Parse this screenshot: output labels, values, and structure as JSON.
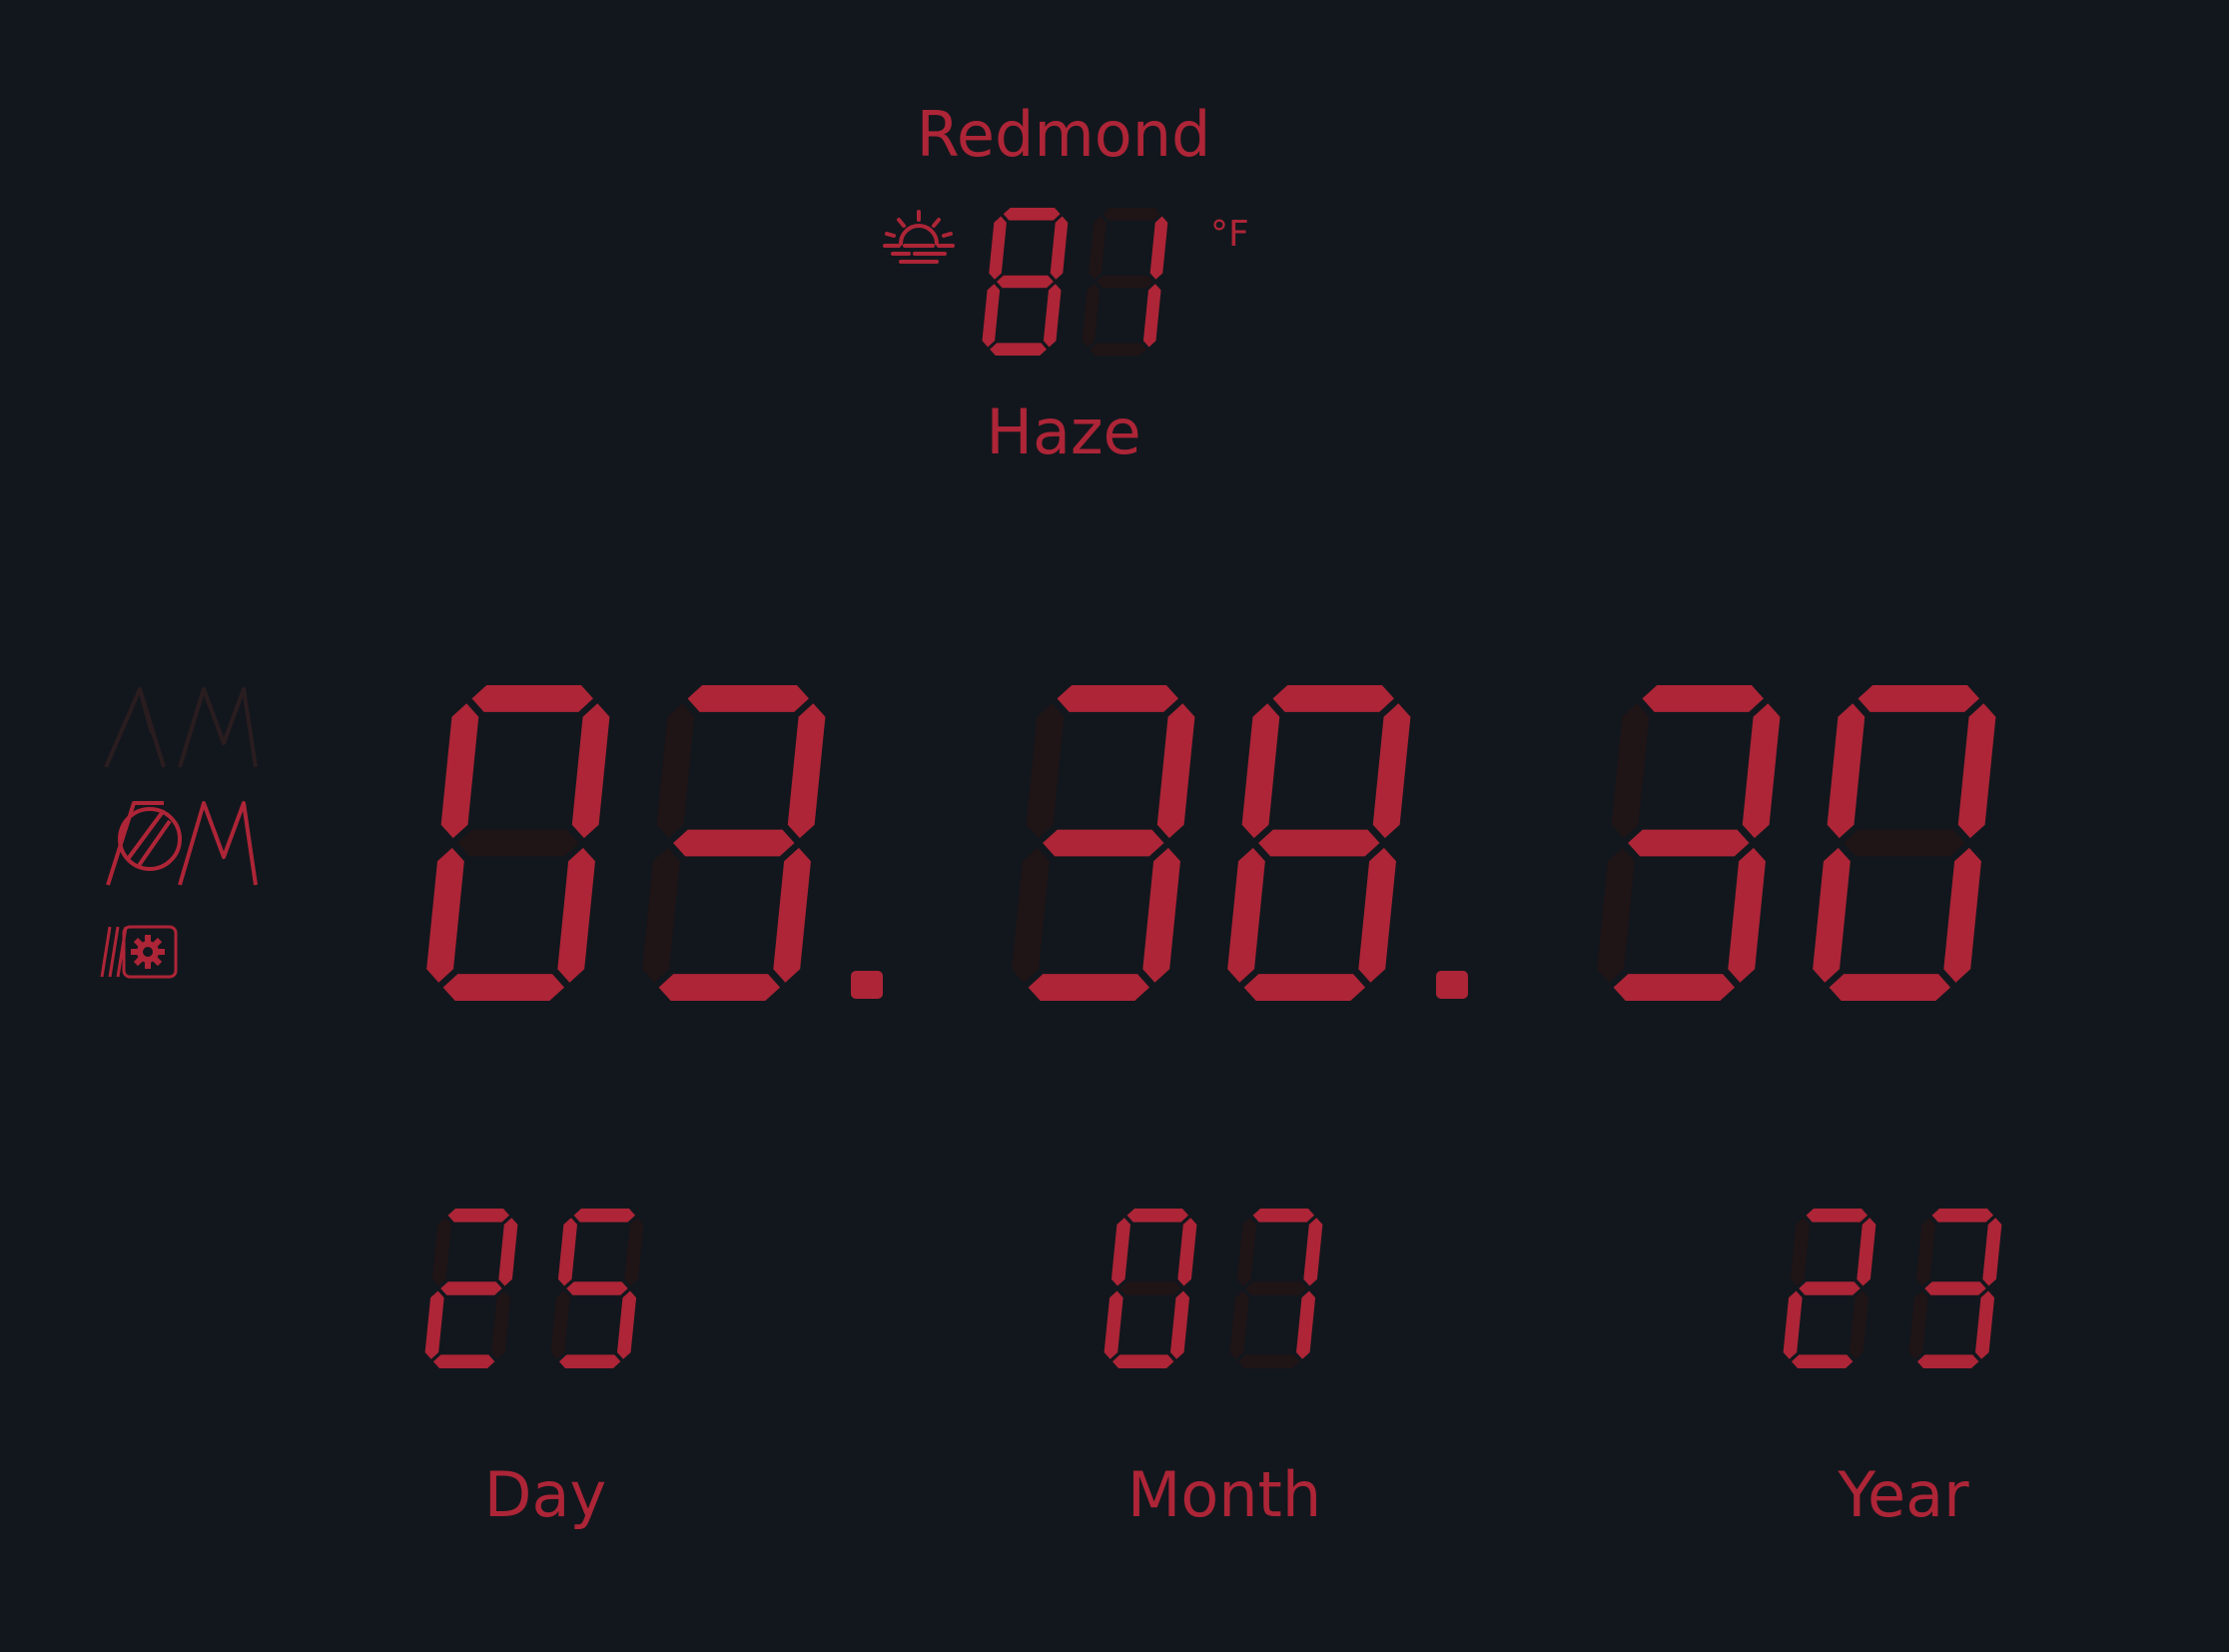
{
  "weather": {
    "city": "Redmond",
    "temperature": "81",
    "unit": "°F",
    "condition": "Haze",
    "condition_icon": "sunrise-haze-icon"
  },
  "clock": {
    "hours": "03",
    "minutes": "38",
    "seconds": "30",
    "separator": "."
  },
  "date": {
    "day": "25",
    "month": "07",
    "year": "23",
    "day_label": "Day",
    "month_label": "Month",
    "year_label": "Year"
  },
  "side_controls": {
    "am_indicator": "AM",
    "pm_indicator": "PM",
    "am_active": false,
    "pm_active": true,
    "settings_icon": "gear-icon"
  },
  "colors": {
    "background": "#12171d",
    "segment_on": "#ad2537",
    "segment_off": "#1f1416"
  }
}
